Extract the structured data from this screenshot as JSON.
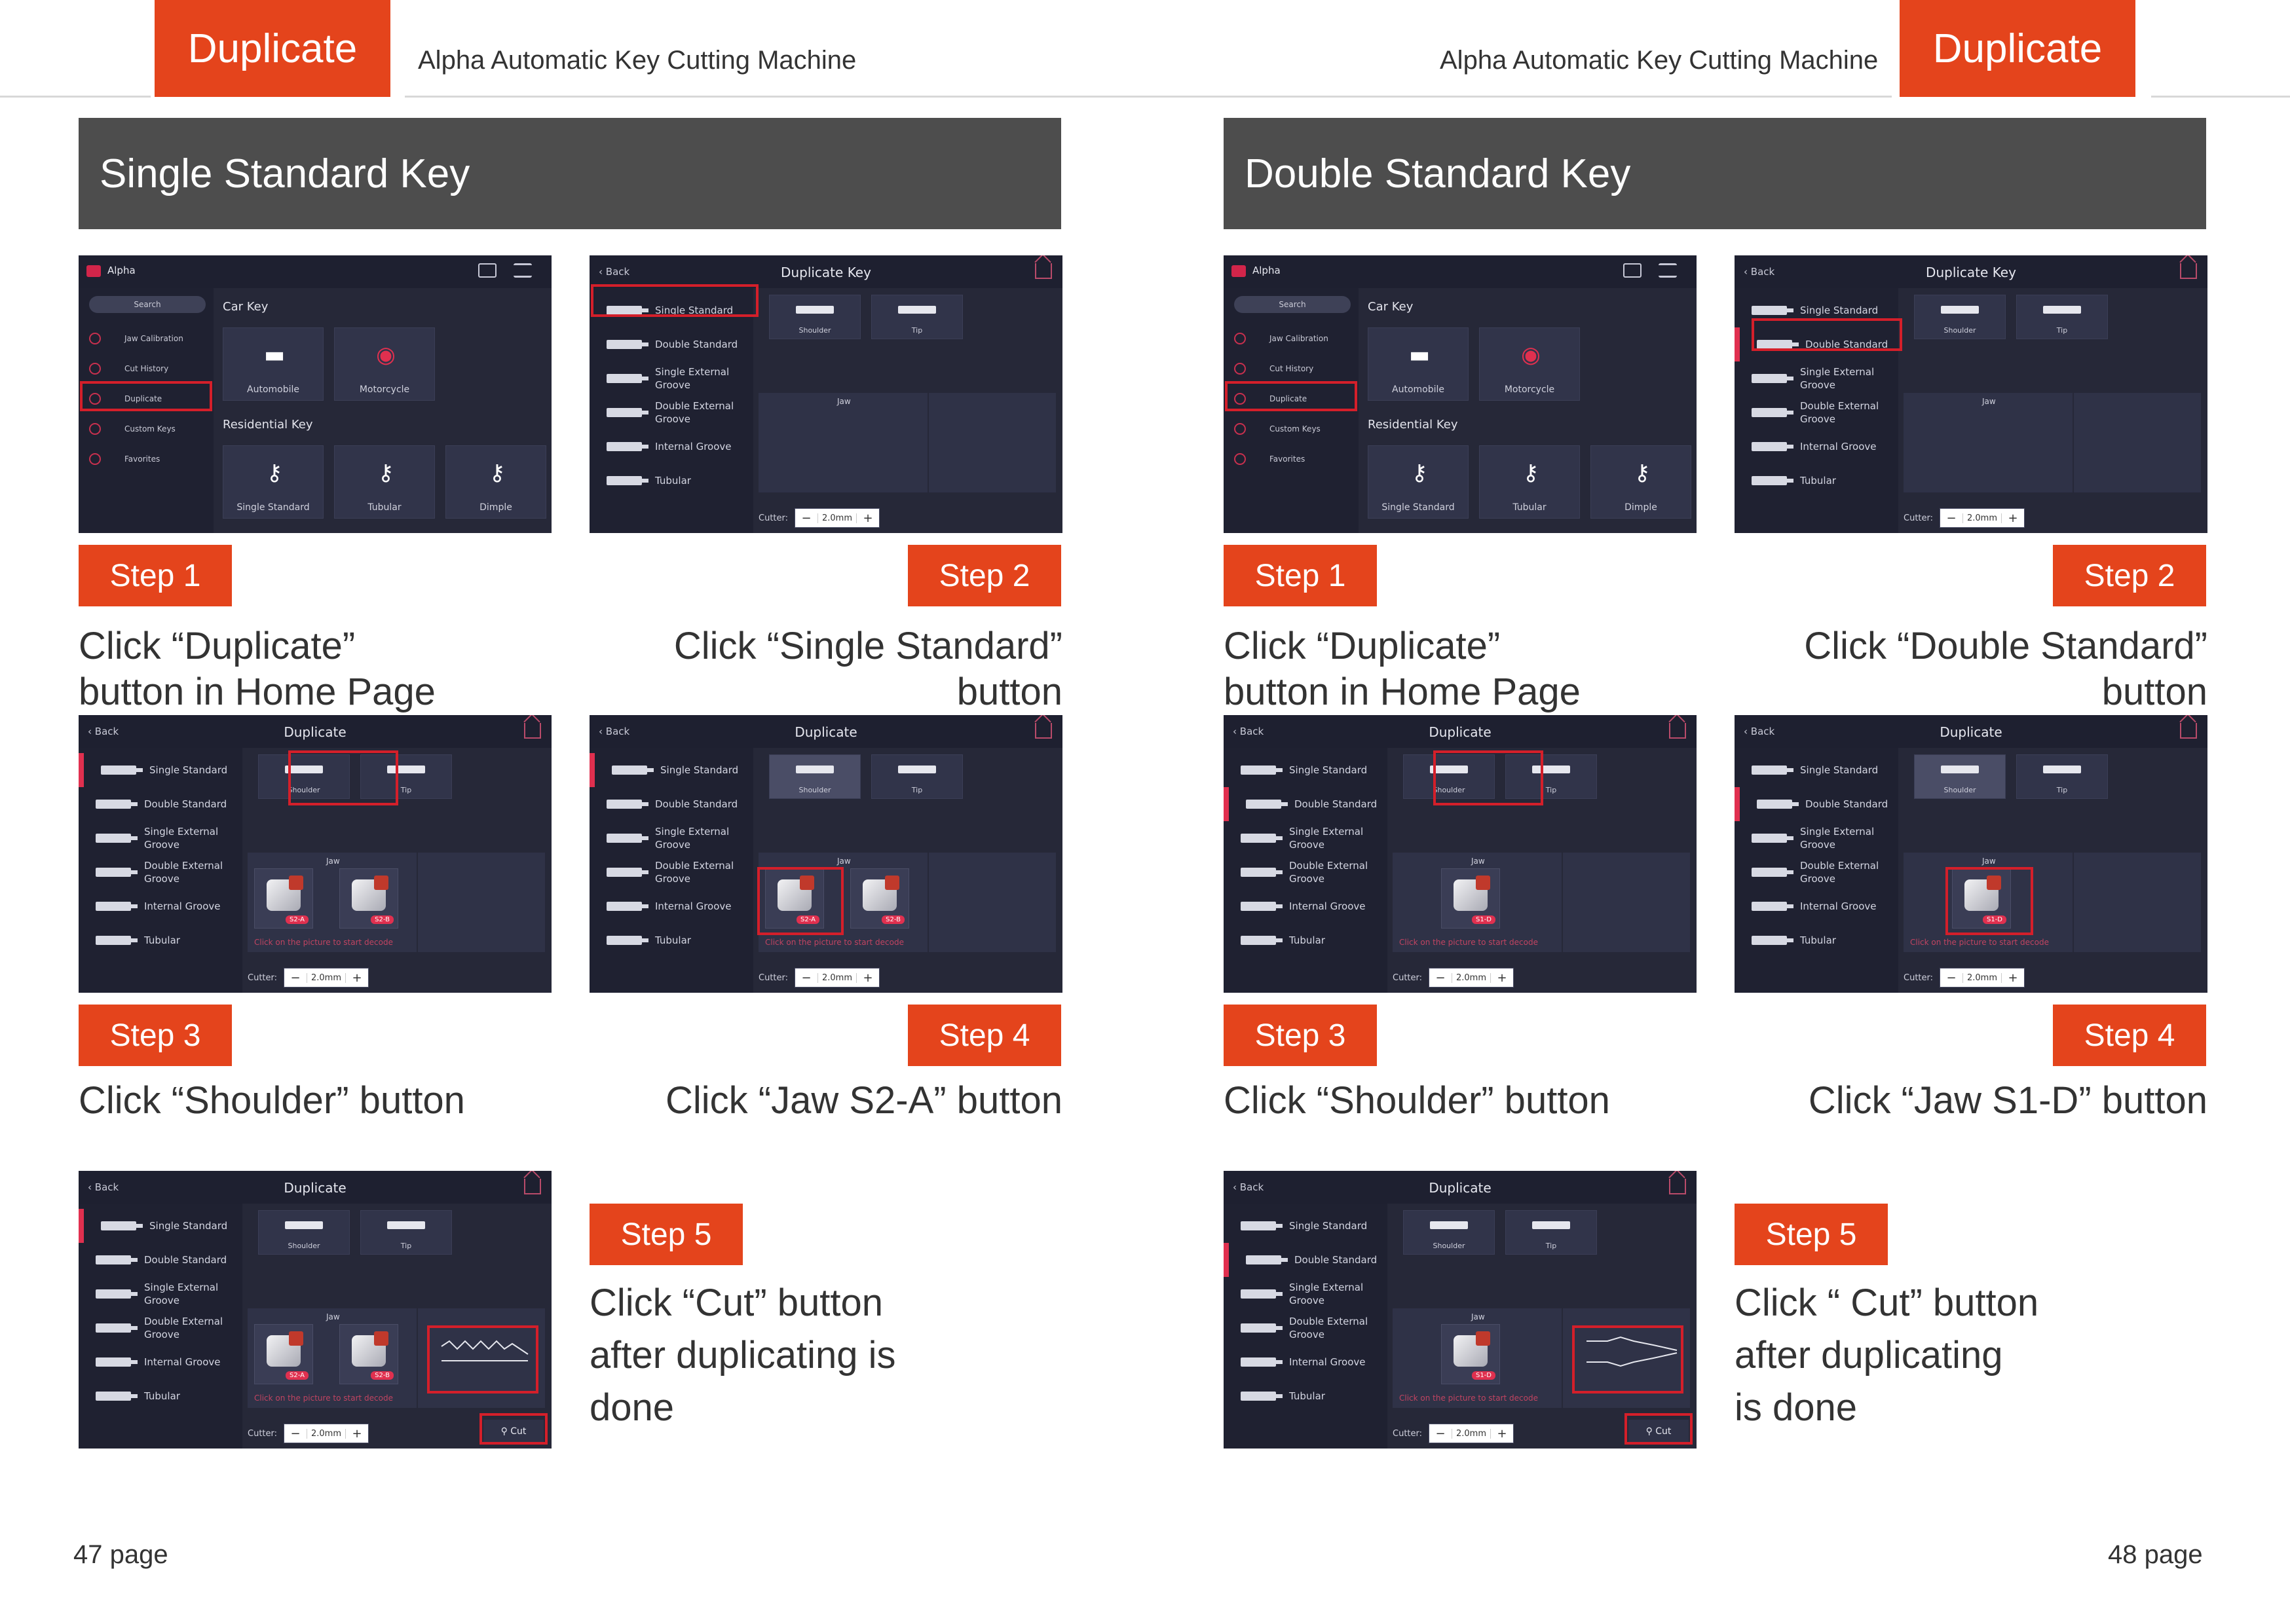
{
  "header": {
    "tab_label": "Duplicate",
    "machine_title": "Alpha Automatic Key Cutting Machine"
  },
  "left_page": {
    "banner": "Single Standard Key",
    "page_number": "47 page",
    "steps": [
      {
        "label": "Step 1",
        "caption": "Click “Duplicate”\nbutton in Home Page"
      },
      {
        "label": "Step 2",
        "caption": "Click “Single Standard”\nbutton"
      },
      {
        "label": "Step 3",
        "caption": "Click “Shoulder” button"
      },
      {
        "label": "Step 4",
        "caption": "Click “Jaw S2-A” button"
      },
      {
        "label": "Step 5",
        "caption": "Click “Cut” button\nafter duplicating is\ndone"
      }
    ]
  },
  "right_page": {
    "banner": "Double Standard Key",
    "page_number": "48 page",
    "steps": [
      {
        "label": "Step 1",
        "caption": "Click “Duplicate”\nbutton in Home Page"
      },
      {
        "label": "Step 2",
        "caption": "Click “Double  Standard”\nbutton"
      },
      {
        "label": "Step 3",
        "caption": "Click “Shoulder” button"
      },
      {
        "label": "Step 4",
        "caption": "Click “Jaw S1-D” button"
      },
      {
        "label": "Step 5",
        "caption": "Click “ Cut” button\nafter duplicating\nis done"
      }
    ]
  },
  "app": {
    "brand": "Alpha",
    "search": "Search",
    "home_menu": [
      "Jaw Calibration",
      "Cut History",
      "Duplicate",
      "Custom Keys",
      "Favorites"
    ],
    "car_key": "Car Key",
    "residential_key": "Residential Key",
    "car_items": [
      "Automobile",
      "Motorcycle"
    ],
    "res_items": [
      "Single Standard",
      "Tubular",
      "Dimple"
    ],
    "back": "Back",
    "title_duplicate_key": "Duplicate Key",
    "title_duplicate": "Duplicate",
    "key_types": [
      "Single Standard",
      "Double Standard",
      "Single External\nGroove",
      "Double External\nGroove",
      "Internal Groove",
      "Tubular"
    ],
    "shoulder": "Shoulder",
    "tip": "Tip",
    "jaw": "Jaw",
    "jaw_hint": "Click on the picture to start decode",
    "cutter_label": "Cutter:",
    "cutter_value": "2.0mm",
    "minus": "−",
    "plus": "+",
    "cut": "Cut",
    "jaw_tags": [
      "S2-A",
      "S2-B",
      "S1-D"
    ],
    "icons": {
      "car": "car-icon",
      "moto": "motorcycle-icon",
      "key": "key-icon"
    }
  }
}
